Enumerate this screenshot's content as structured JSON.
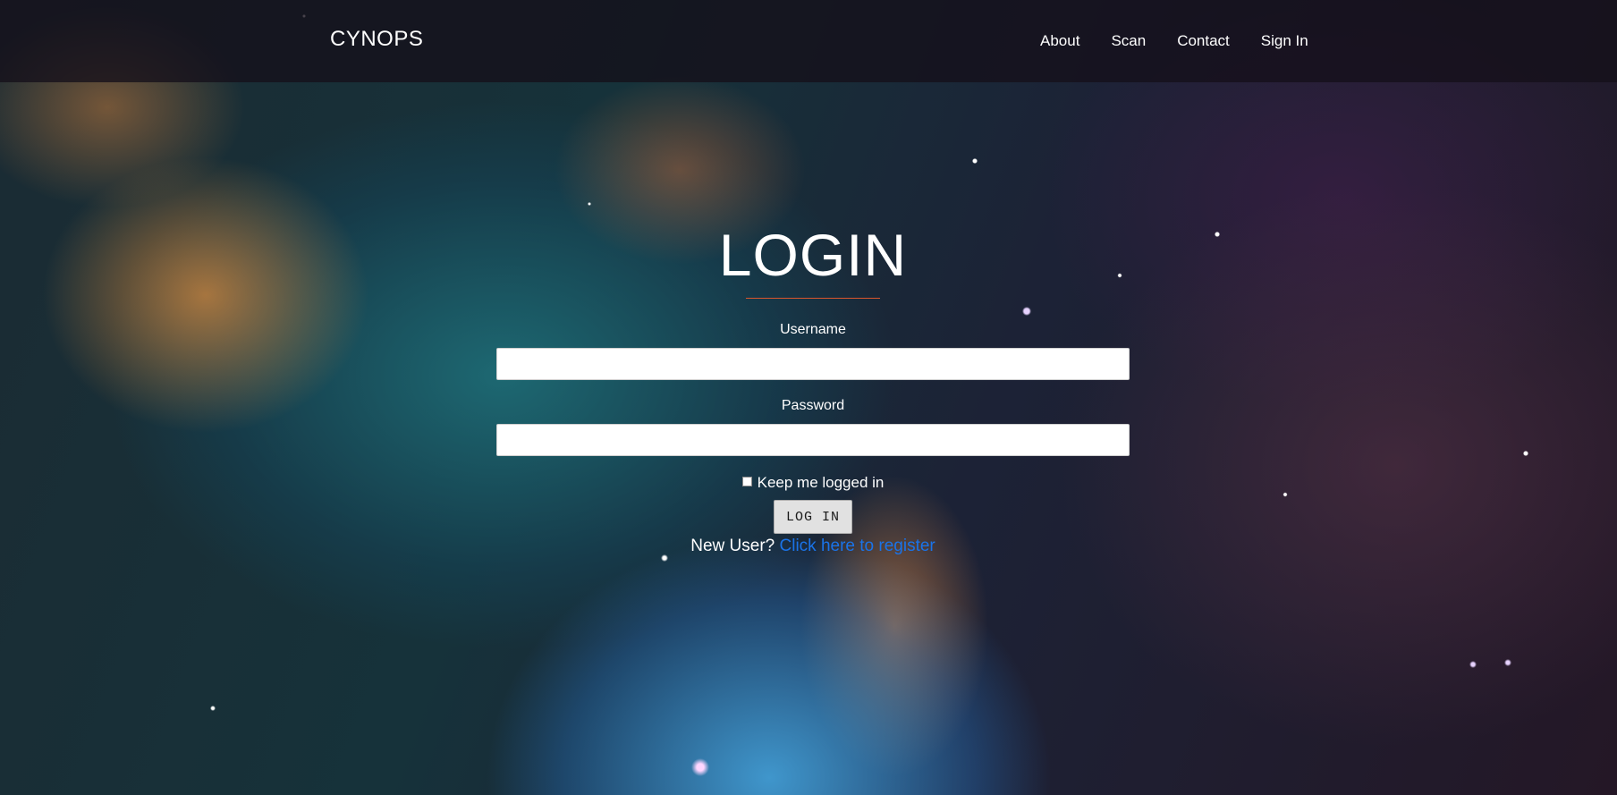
{
  "navbar": {
    "brand": "CYNOPS",
    "links": [
      {
        "label": "About"
      },
      {
        "label": "Scan"
      },
      {
        "label": "Contact"
      },
      {
        "label": "Sign In"
      }
    ]
  },
  "login": {
    "title": "LOGIN",
    "username_label": "Username",
    "username_value": "",
    "password_label": "Password",
    "password_value": "",
    "remember_label": "Keep me logged in",
    "remember_checked": false,
    "submit_label": "LOG IN",
    "new_user_text": "New User?",
    "register_link": "Click here to register"
  },
  "colors": {
    "title_rule": "#d9562d",
    "register_link": "#1a73e8",
    "navbar_bg": "#14101a"
  }
}
